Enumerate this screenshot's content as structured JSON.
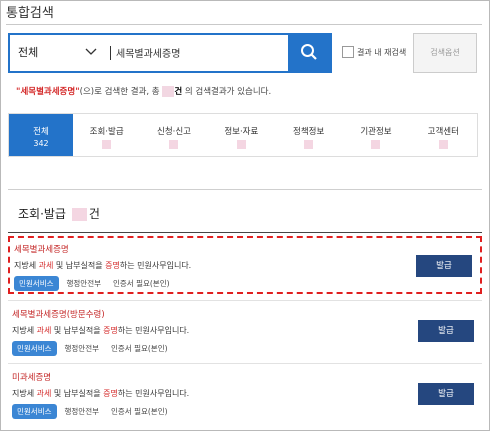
{
  "page": {
    "title": "통합검색"
  },
  "search": {
    "scope": "전체",
    "query": "세목별과세증명",
    "within_label": "결과 내 재검색",
    "advanced_label": "검색옵션"
  },
  "result": {
    "quote_open": "\"",
    "keyword": "세목별과세증명",
    "quote_close": "\"",
    "prefix_text": "(으)로 검색한 결과, 총 ",
    "count_suffix": "건",
    "suffix_text": " 의 검색결과가 있습니다."
  },
  "tabs": [
    {
      "label": "전체",
      "count": "342",
      "active": true
    },
    {
      "label": "조회·발급"
    },
    {
      "label": "신청·신고"
    },
    {
      "label": "정보·자료"
    },
    {
      "label": "정책정보"
    },
    {
      "label": "기관정보"
    },
    {
      "label": "고객센터"
    }
  ],
  "section": {
    "title": "조회·발급",
    "suffix": "건"
  },
  "items": [
    {
      "title": "세목별과세증명",
      "desc_1": "지방세 ",
      "desc_hl_1": "과세",
      "desc_2": " 및 납부실적을 ",
      "desc_hl_2": "증명",
      "desc_3": "하는 민원사무입니다.",
      "badge": "민원서비스",
      "org": "행정안전부",
      "cert": "인증서 필요(본인)",
      "button": "발급"
    },
    {
      "title": "세목별과세증명(방문수령)",
      "desc_1": "지방세 ",
      "desc_hl_1": "과세",
      "desc_2": " 및 납부실적을 ",
      "desc_hl_2": "증명",
      "desc_3": "하는 민원사무입니다.",
      "badge": "민원서비스",
      "org": "행정안전부",
      "cert": "인증서 필요(본인)",
      "button": "발급"
    },
    {
      "title": "미과세증명",
      "desc_1": "지방세 ",
      "desc_hl_1": "과세",
      "desc_2": " 및 납부실적을 ",
      "desc_hl_2": "증명",
      "desc_3": "하는 민원사무입니다.",
      "badge": "민원서비스",
      "org": "행정안전부",
      "cert": "인증서 필요(본인)",
      "button": "발급"
    }
  ],
  "colors": {
    "primary": "#2373c9",
    "button": "#25477f",
    "highlight": "#d42a2a",
    "badge": "#3b86d4"
  }
}
